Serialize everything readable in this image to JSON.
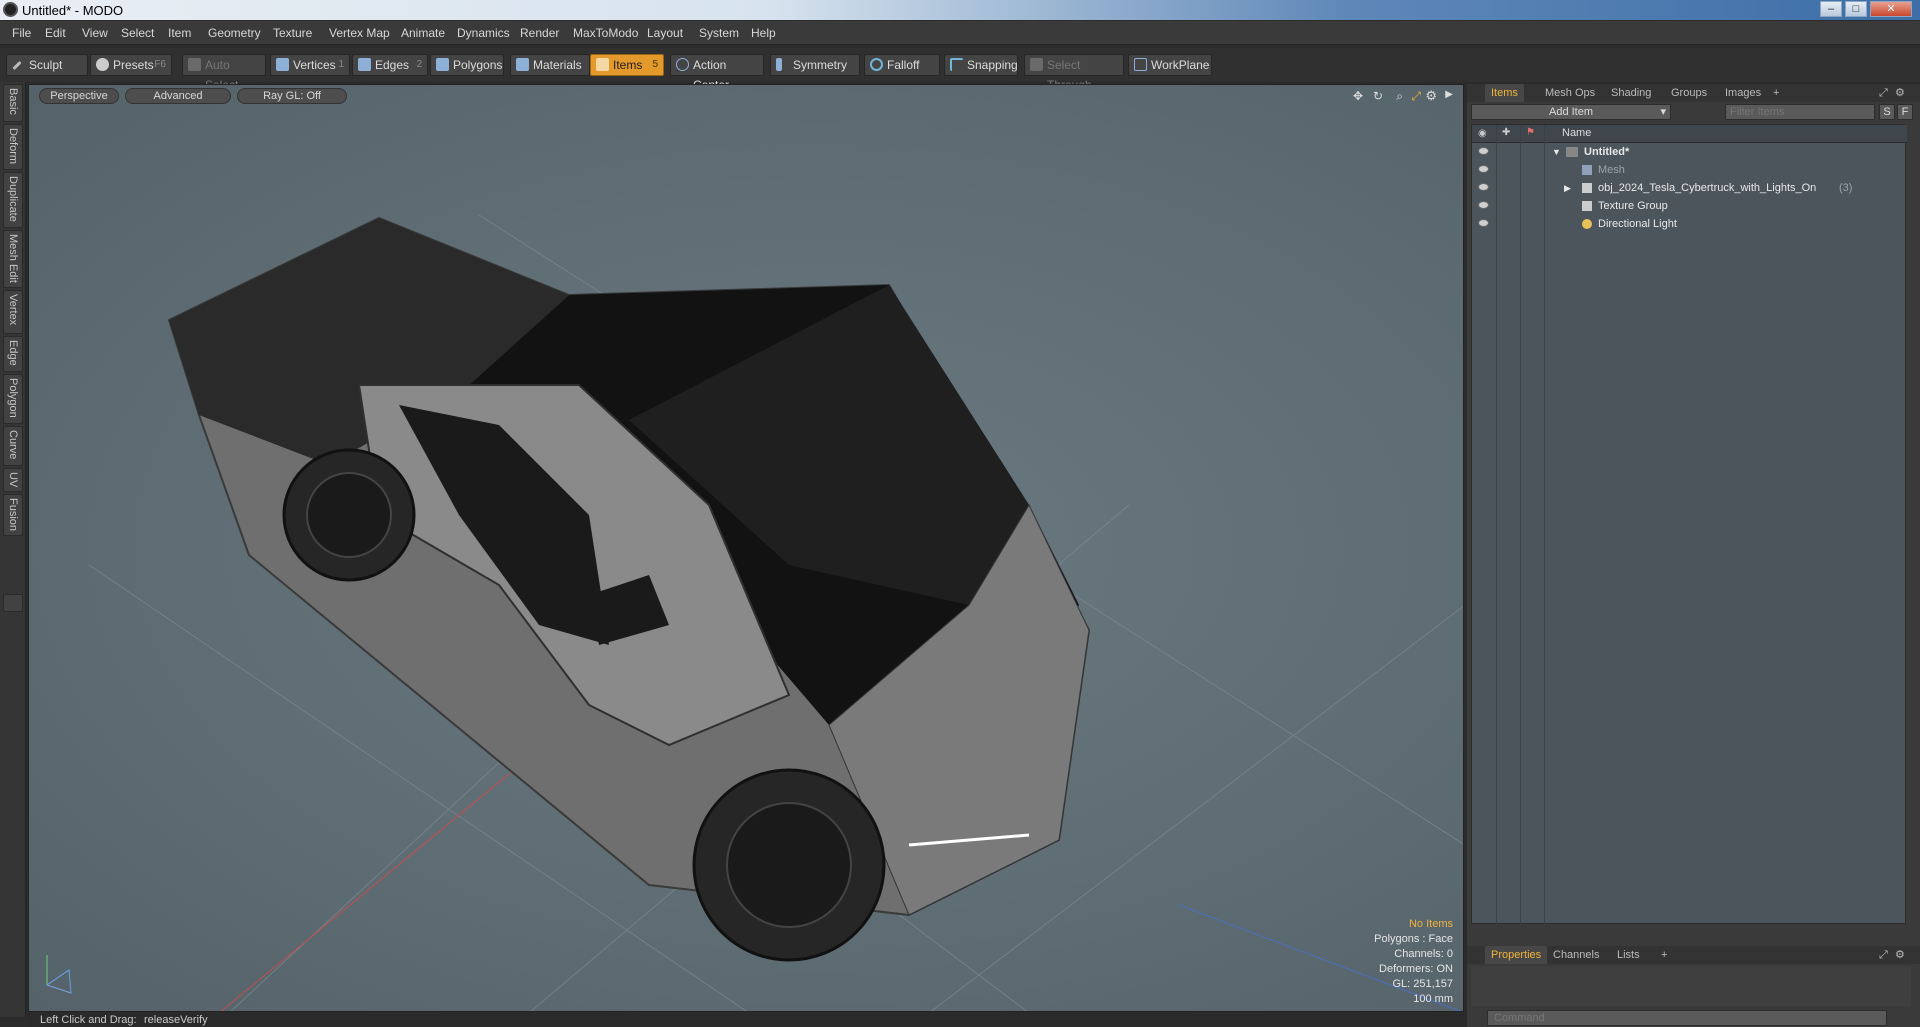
{
  "window": {
    "title": "Untitled* - MODO",
    "minimize": "–",
    "maximize": "□",
    "close": "✕"
  },
  "menu": [
    "File",
    "Edit",
    "View",
    "Select",
    "Item",
    "Geometry",
    "Texture",
    "Vertex Map",
    "Animate",
    "Dynamics",
    "Render",
    "MaxToModo",
    "Layout",
    "System",
    "Help"
  ],
  "toolbar": {
    "sculpt": "Sculpt",
    "presets": "Presets",
    "presets_key": "F6",
    "auto_select": "Auto Select",
    "vertices": "Vertices",
    "vertices_key": "1",
    "edges": "Edges",
    "edges_key": "2",
    "polygons": "Polygons",
    "materials": "Materials",
    "items": "Items",
    "items_key": "5",
    "action_center": "Action Center",
    "symmetry": "Symmetry",
    "falloff": "Falloff",
    "snapping": "Snapping",
    "select_through": "Select Through",
    "workplane": "WorkPlane"
  },
  "left_tabs": [
    "Basic",
    "Deform",
    "Duplicate",
    "Mesh Edit",
    "Vertex",
    "Edge",
    "Polygon",
    "Curve",
    "UV",
    "Fusion"
  ],
  "viewport": {
    "view": "Perspective",
    "shading": "Advanced",
    "raygl": "Ray GL: Off",
    "status": {
      "selection": "No Items",
      "polygons": "Polygons : Face",
      "channels": "Channels: 0",
      "deformers": "Deformers: ON",
      "gl": "GL: 251,157",
      "grid": "100 mm"
    }
  },
  "statusbar": {
    "hint": "Left Click and Drag:",
    "action": "releaseVerify"
  },
  "right_panel": {
    "tabs": [
      "Items",
      "Mesh Ops",
      "Shading",
      "Groups",
      "Images"
    ],
    "add_item": "Add Item",
    "filter_placeholder": "Filter Items",
    "filter_s": "S",
    "filter_f": "F",
    "name_header": "Name",
    "tree": [
      {
        "label": "Untitled*",
        "bold": true
      },
      {
        "label": "Mesh",
        "dim": true
      },
      {
        "label": "obj_2024_Tesla_Cybertruck_with_Lights_On",
        "count": "(3)"
      },
      {
        "label": "Texture Group"
      },
      {
        "label": "Directional Light"
      }
    ],
    "bottom_tabs": [
      "Properties",
      "Channels",
      "Lists"
    ],
    "command_placeholder": "Command"
  },
  "colors": {
    "accent": "#e39a2a",
    "highlight_text": "#f0b33a",
    "viewport_bg": "#5f6d75"
  }
}
